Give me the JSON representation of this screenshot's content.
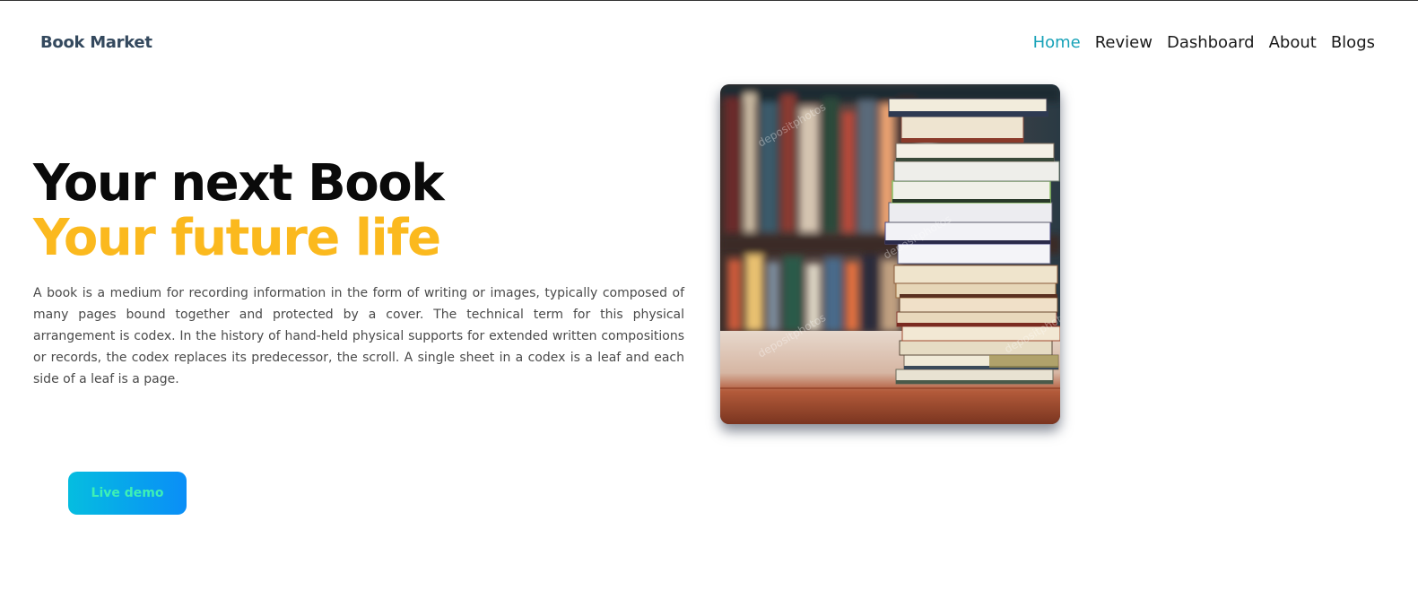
{
  "header": {
    "brand": "Book Market",
    "nav": [
      {
        "label": "Home",
        "active": true
      },
      {
        "label": "Review",
        "active": false
      },
      {
        "label": "Dashboard",
        "active": false
      },
      {
        "label": "About",
        "active": false
      },
      {
        "label": "Blogs",
        "active": false
      }
    ]
  },
  "hero": {
    "title": "Your next Book",
    "subtitle": "Your future life",
    "description": "A book is a medium for recording information in the form of writing or images, typically composed of many pages bound together and protected by a cover. The technical term for this physical arrangement is codex. In the history of hand-held physical supports for extended written compositions or records, the codex replaces its predecessor, the scroll. A single sheet in a codex is a leaf and each side of a leaf is a page.",
    "cta_label": "Live demo",
    "image_watermark": "depositphotos"
  },
  "colors": {
    "accent_yellow": "#fbb91e",
    "nav_active": "#17a2b8",
    "brand_text": "#34495e",
    "button_gradient_start": "#05bde0",
    "button_gradient_end": "#0a8ef7",
    "button_text": "#3ef0b5"
  }
}
